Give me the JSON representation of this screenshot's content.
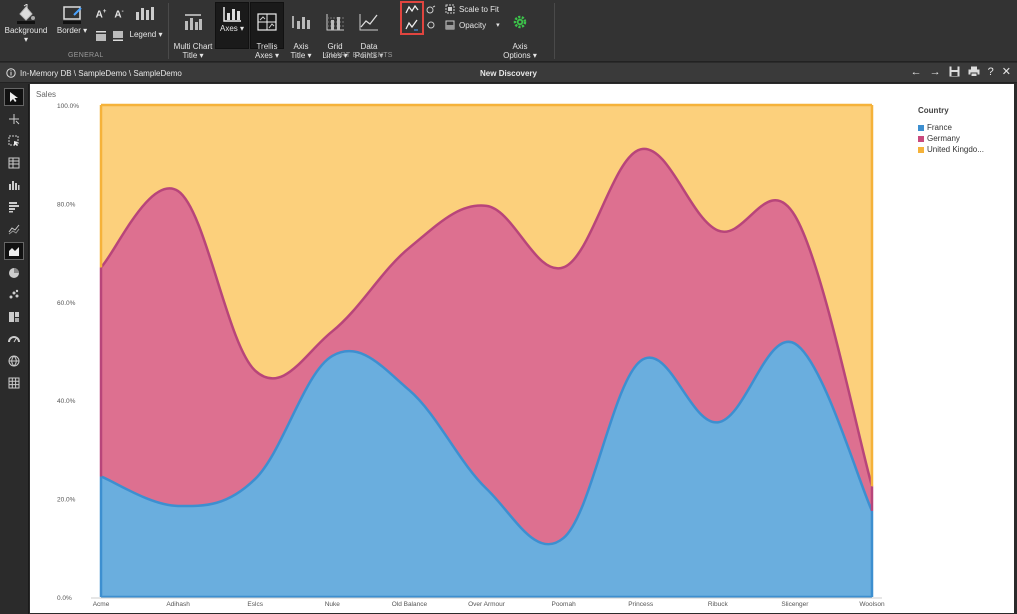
{
  "ribbon": {
    "general": {
      "background_label": "Background ▾",
      "border_label": "Border ▾",
      "legend_label": "Legend ▾",
      "font_up": "A",
      "font_down": "A",
      "group_label": "GENERAL"
    },
    "chart_elements": {
      "multi_chart_title": "Multi Chart\nTitle ▾",
      "axes": "Axes ▾",
      "trellis_axes": "Trellis\nAxes ▾",
      "axis_title": "Axis\nTitle ▾",
      "grid_lines": "Grid\nLines ▾",
      "data_points": "Data\nPoints ▾",
      "scale_to_fit": "Scale to Fit",
      "opacity": "Opacity",
      "axis_options": "Axis\nOptions ▾",
      "group_label": "CHART ELEMENTS"
    }
  },
  "titlebar": {
    "path": "In-Memory DB \\ SampleDemo \\ SampleDemo",
    "title": "New Discovery",
    "help": "?"
  },
  "chart": {
    "sales_label": "Sales",
    "legend_title": "Country",
    "colors": {
      "France": "#6aaede",
      "Germany": "#dd7090",
      "United Kingdom": "#fcd07c"
    },
    "stroke_colors": {
      "France": "#3d8fd0",
      "Germany": "#b8457a",
      "United Kingdom": "#f5b23a"
    }
  },
  "chart_data": {
    "type": "area",
    "stacked": "100%",
    "ylabel": "Sales",
    "y_tick_labels": [
      "0.0%",
      "20.0%",
      "40.0%",
      "60.0%",
      "80.0%",
      "100.0%"
    ],
    "ylim": [
      0,
      100
    ],
    "categories": [
      "Acme",
      "Adihash",
      "Eslcs",
      "Nuke",
      "Old Balance",
      "Over Armour",
      "Poomah",
      "Princess",
      "Ribuck",
      "Slicenger",
      "Woolson"
    ],
    "series": [
      {
        "name": "France",
        "legend_label": "France",
        "values": [
          24.5,
          18.5,
          24,
          49,
          42,
          22,
          12,
          48,
          35.5,
          51.5,
          17.5
        ]
      },
      {
        "name": "Germany",
        "legend_label": "Germany",
        "values": [
          42.5,
          64,
          22,
          5,
          29,
          57.5,
          55,
          43,
          39,
          26,
          5
        ]
      },
      {
        "name": "United Kingdom",
        "legend_label": "United Kingdo...",
        "values": [
          33,
          17.5,
          54,
          46,
          29,
          20.5,
          33,
          9,
          25.5,
          22.5,
          77.5
        ]
      }
    ],
    "legend_position": "right",
    "grid": true
  }
}
